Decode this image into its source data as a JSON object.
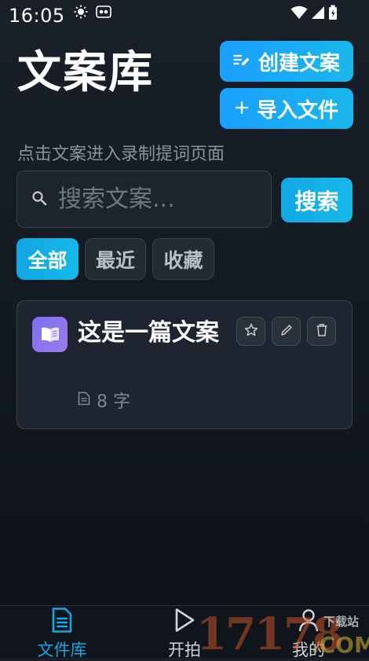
{
  "status_bar": {
    "time": "16:05",
    "icons": [
      "brightness-icon",
      "sync-icon",
      "wifi-icon",
      "signal-icon",
      "battery-icon"
    ]
  },
  "header": {
    "title": "文案库",
    "create_label": "创建文案",
    "import_label": "导入文件",
    "subtitle": "点击文案进入录制提词页面"
  },
  "search": {
    "placeholder": "搜索文案...",
    "button_label": "搜索"
  },
  "tabs": [
    {
      "label": "全部",
      "active": true
    },
    {
      "label": "最近",
      "active": false
    },
    {
      "label": "收藏",
      "active": false
    }
  ],
  "documents": [
    {
      "title": "这是一篇文案",
      "word_count": "8 字"
    }
  ],
  "bottom_nav": [
    {
      "label": "文件库",
      "icon": "document-icon",
      "active": true
    },
    {
      "label": "开拍",
      "icon": "play-icon",
      "active": false
    },
    {
      "label": "我的",
      "icon": "profile-icon",
      "active": false
    }
  ],
  "watermark": {
    "digits": "17178",
    "site": "下载站",
    "suffix": ".COM"
  },
  "colors": {
    "accent": "#12a7e6",
    "card_bg": "#1e2530",
    "icon_purple": "#8a74ec"
  }
}
